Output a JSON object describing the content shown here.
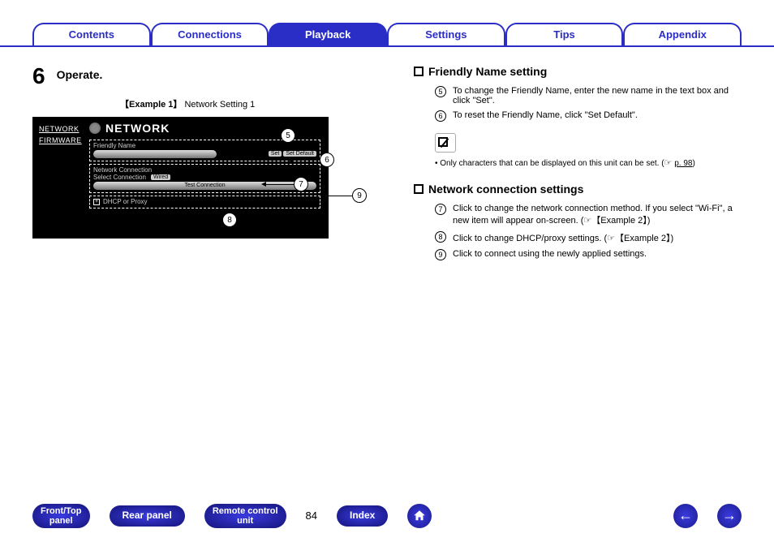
{
  "tabs": {
    "contents": "Contents",
    "connections": "Connections",
    "playback": "Playback",
    "settings": "Settings",
    "tips": "Tips",
    "appendix": "Appendix"
  },
  "step": {
    "number": "6",
    "title": "Operate.",
    "example_prefix": "【Example 1】",
    "example_text": " Network Setting 1"
  },
  "net_panel": {
    "side": {
      "network": "NETWORK",
      "firmware": "FIRMWARE"
    },
    "title": "NETWORK",
    "friendly_name_label": "Friendly Name",
    "btn_set": "Set",
    "btn_set_default": "Set Default",
    "network_connection_label": "Network Connection",
    "select_connection": "Select Connection",
    "wired": "Wired",
    "test_connection": "Test Connection",
    "dhcp_or_proxy": "DHCP or Proxy"
  },
  "callouts": {
    "c5": "5",
    "c6": "6",
    "c7": "7",
    "c8": "8",
    "c9": "9"
  },
  "right": {
    "h_friendly": "Friendly Name setting",
    "i5": "To change the Friendly Name, enter the new name in the text box and click \"Set\".",
    "i6": "To reset the Friendly Name, click \"Set Default\".",
    "note_bullet": "• Only characters that can be displayed on this unit can be set. (",
    "note_page_link": "p. 98",
    "note_close": ")",
    "h_network": "Network connection settings",
    "i7_a": "Click to change the network connection method. If you select \"Wi-Fi\", a new item will appear on-screen. (",
    "i7_ref": "【Example 2】",
    "i7_b": ")",
    "i8_a": "Click to change DHCP/proxy settings. (",
    "i8_ref": "【Example 2】",
    "i8_b": ")",
    "i9": "Click to connect using the newly applied settings."
  },
  "bottom": {
    "front_top": "Front/Top panel",
    "rear": "Rear panel",
    "remote": "Remote control unit",
    "page": "84",
    "index": "Index"
  }
}
